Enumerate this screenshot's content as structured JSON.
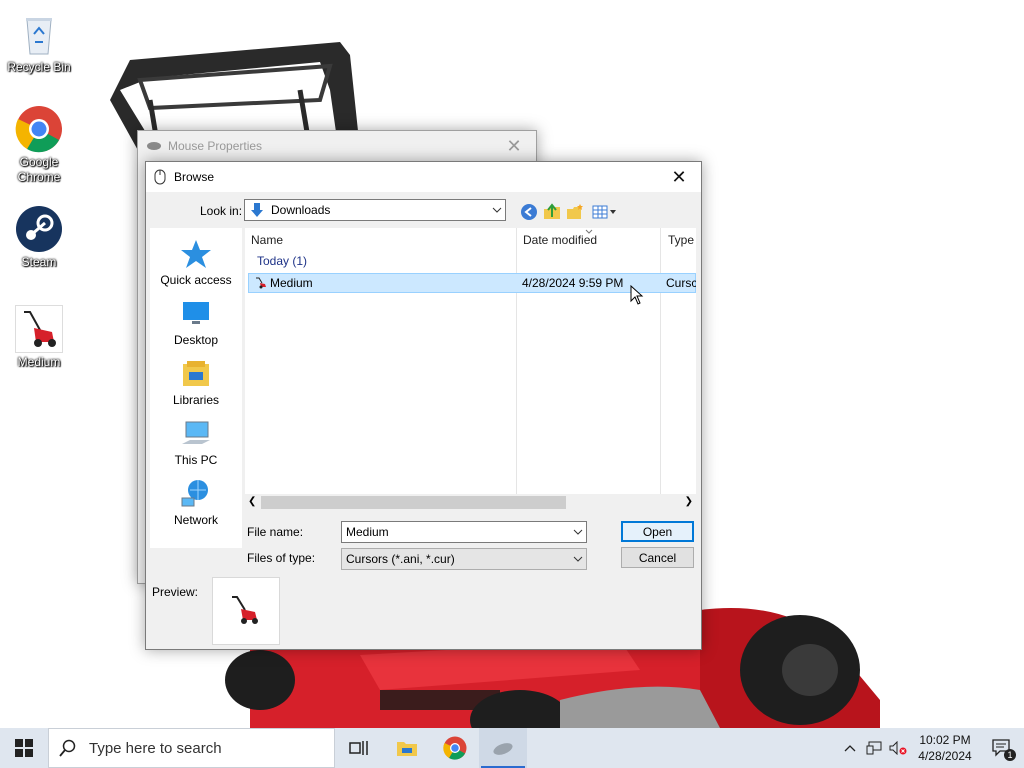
{
  "desktop": {
    "icons": [
      {
        "label": "Recycle Bin",
        "icon": "recycle-bin-icon"
      },
      {
        "label": "Google Chrome",
        "icon": "chrome-icon"
      },
      {
        "label": "Steam",
        "icon": "steam-icon"
      },
      {
        "label": "Medium",
        "icon": "lawnmower-cursor-icon"
      }
    ]
  },
  "mouse_properties": {
    "title": "Mouse Properties"
  },
  "browse": {
    "title": "Browse",
    "look_in_label": "Look in:",
    "look_in_value": "Downloads",
    "toolbar_icons": [
      "back-icon",
      "up-folder-icon",
      "new-folder-icon",
      "view-menu-icon"
    ],
    "places": [
      {
        "label": "Quick access",
        "icon": "quick-access-star-icon"
      },
      {
        "label": "Desktop",
        "icon": "desktop-icon"
      },
      {
        "label": "Libraries",
        "icon": "libraries-icon"
      },
      {
        "label": "This PC",
        "icon": "this-pc-icon"
      },
      {
        "label": "Network",
        "icon": "network-icon"
      }
    ],
    "columns": {
      "name": "Name",
      "date": "Date modified",
      "type": "Type"
    },
    "group_header": "Today (1)",
    "files": [
      {
        "name": "Medium",
        "date": "4/28/2024 9:59 PM",
        "type": "Cursc",
        "selected": true
      }
    ],
    "file_name_label": "File name:",
    "file_name_value": "Medium",
    "files_of_type_label": "Files of type:",
    "files_of_type_value": "Cursors (*.ani, *.cur)",
    "open_label": "Open",
    "cancel_label": "Cancel",
    "preview_label": "Preview:"
  },
  "taskbar": {
    "search_placeholder": "Type here to search",
    "apps": [
      "task-view-icon",
      "file-explorer-icon",
      "chrome-icon",
      "mouse-properties-icon"
    ],
    "time": "10:02 PM",
    "date": "4/28/2024",
    "notification_count": "1"
  },
  "colors": {
    "accent": "#0078d7",
    "selection": "#cce8ff",
    "taskbar": "#dfe6ef",
    "mower_red": "#d6202a"
  }
}
